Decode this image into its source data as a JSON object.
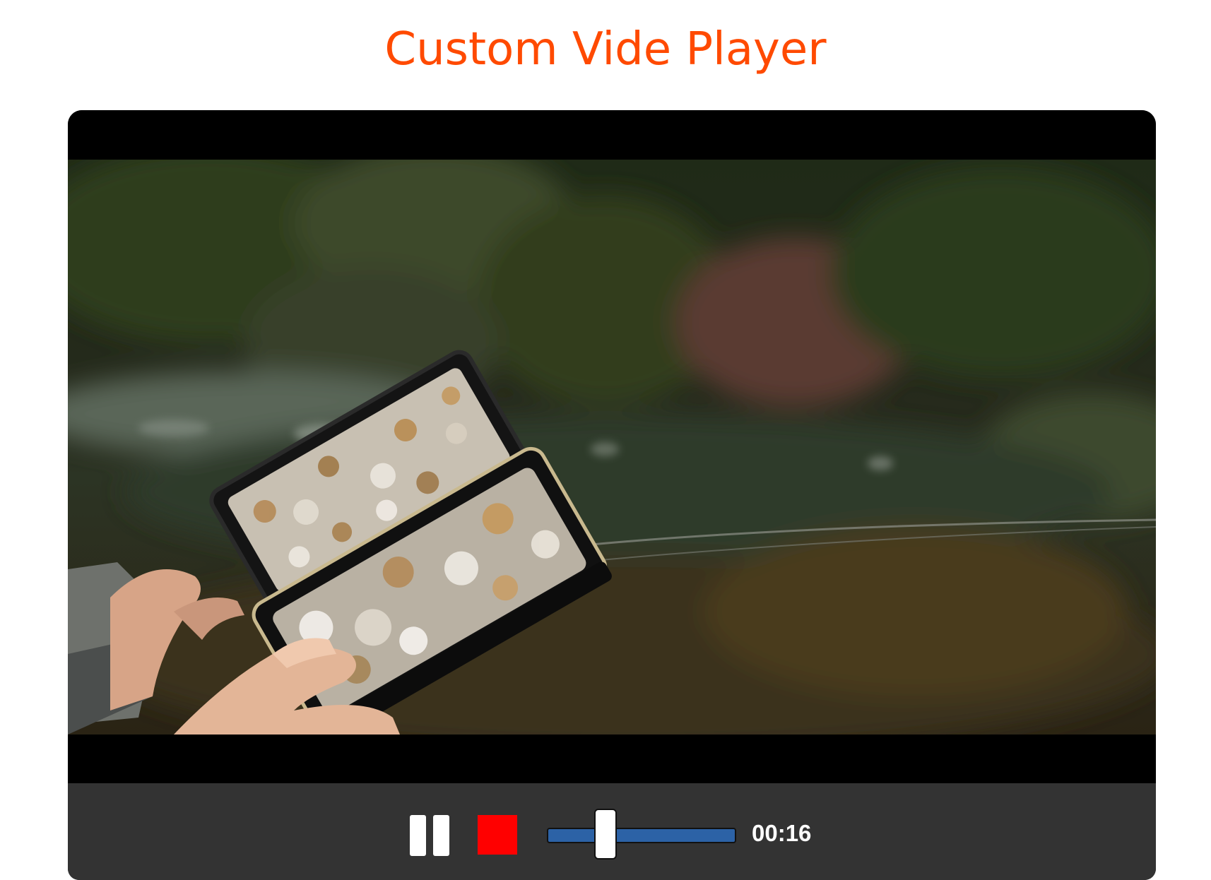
{
  "page": {
    "title": "Custom Vide Player"
  },
  "player": {
    "controls": {
      "pause_icon": "pause-icon",
      "stop_icon": "stop-square-icon",
      "progress_fraction": 0.31,
      "time": "00:16"
    }
  },
  "colors": {
    "title": "#ff4a00",
    "controls_bg": "#333333",
    "stop": "#ff0000",
    "seek_track": "#2c62a6"
  }
}
